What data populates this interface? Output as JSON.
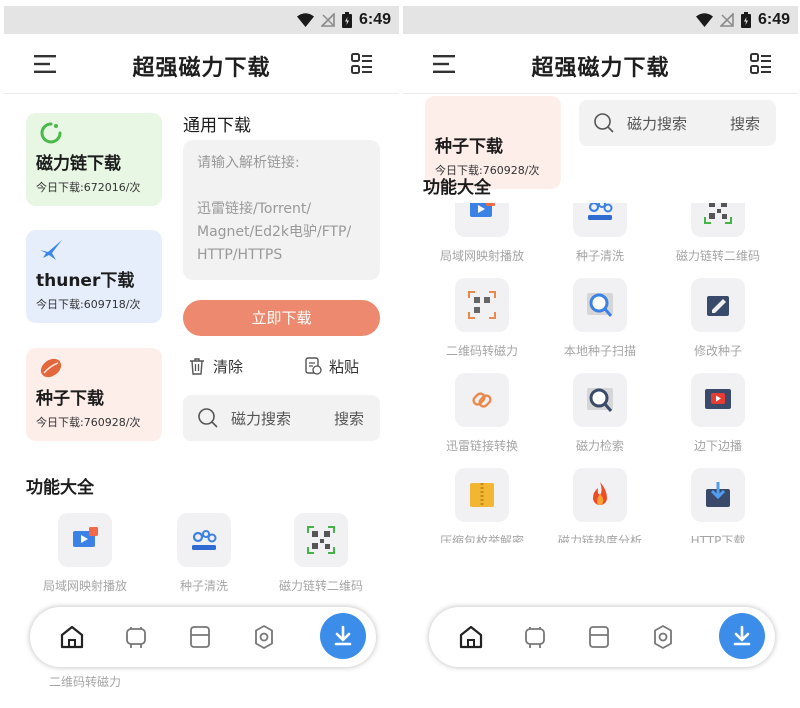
{
  "status": {
    "time": "6:49"
  },
  "app": {
    "title": "超强磁力下载"
  },
  "cards": [
    {
      "title": "磁力链下载",
      "count": "今日下载:672016/次"
    },
    {
      "title": "thuner下载",
      "count": "今日下载:609718/次"
    },
    {
      "title": "种子下载",
      "count": "今日下载:760928/次"
    }
  ],
  "general": {
    "title": "通用下载",
    "placeholder": "请输入解析链接:\n\n迅雷链接/Torrent/\nMagnet/Ed2k电驴/FTP/\nHTTP/HTTPS",
    "download_label": "立即下载",
    "clear_label": "清除",
    "paste_label": "粘贴"
  },
  "search": {
    "placeholder": "磁力搜索",
    "button": "搜索"
  },
  "features": {
    "title": "功能大全",
    "items": [
      {
        "label": "局域网映射播放",
        "icon": "cast-video-icon"
      },
      {
        "label": "种子清洗",
        "icon": "gears-icon"
      },
      {
        "label": "磁力链转二维码",
        "icon": "qrcode-icon"
      },
      {
        "label": "二维码转磁力",
        "icon": "qr-scan-icon"
      },
      {
        "label": "本地种子扫描",
        "icon": "magnifier-icon"
      },
      {
        "label": "修改种子",
        "icon": "edit-file-icon"
      },
      {
        "label": "迅雷链接转换",
        "icon": "link-chain-icon"
      },
      {
        "label": "磁力检索",
        "icon": "job-search-icon"
      },
      {
        "label": "边下边播",
        "icon": "play-video-icon"
      },
      {
        "label": "压缩包枚举解密",
        "icon": "zip-folder-icon"
      },
      {
        "label": "磁力链热度分析",
        "icon": "fire-icon"
      },
      {
        "label": "HTTP下载",
        "icon": "box-download-icon"
      }
    ]
  },
  "nav": {
    "items": [
      "home-icon",
      "chat-icon",
      "layers-icon",
      "settings-icon",
      "download-icon"
    ]
  },
  "colors": {
    "accent": "#3c8dea",
    "download_button": "#ec896e",
    "highlight": "#6fd26a"
  }
}
